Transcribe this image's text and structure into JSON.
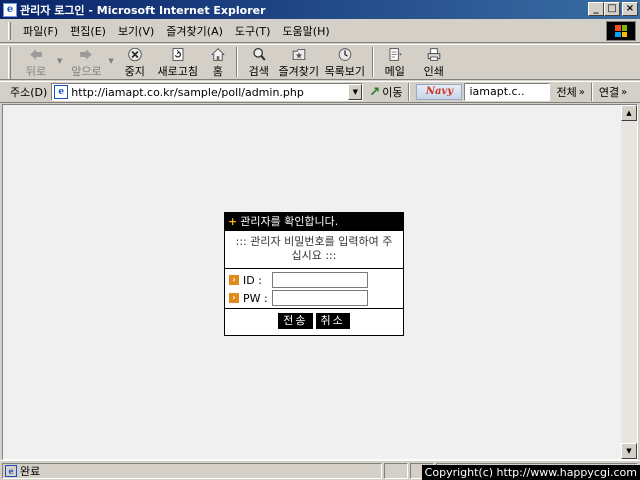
{
  "window": {
    "title": "관리자 로그인 - Microsoft Internet Explorer",
    "controls": {
      "minimize": "_",
      "maximize": "□",
      "close": "×"
    }
  },
  "menu": [
    "파일(F)",
    "편집(E)",
    "보기(V)",
    "즐겨찾기(A)",
    "도구(T)",
    "도움말(H)"
  ],
  "toolbar": {
    "back": "뒤로",
    "forward": "앞으로",
    "stop": "중지",
    "refresh": "새로고침",
    "home": "홈",
    "search": "검색",
    "favorites": "즐겨찾기",
    "history": "목록보기",
    "mail": "메일",
    "print": "인쇄"
  },
  "address": {
    "label": "주소(D)",
    "url": "http://iamapt.co.kr/sample/poll/admin.php",
    "go": "이동",
    "navy_logo": "Navy",
    "navy_search": "iamapt.c..",
    "navy_all": "전체",
    "links": "연결"
  },
  "login": {
    "header": "관리자를 확인합니다.",
    "message": "::: 관리자 비밀번호를 입력하여 주십시요 :::",
    "id_label": "ID :",
    "pw_label": "PW :",
    "id_value": "",
    "pw_value": "",
    "submit": "전송",
    "cancel": "취소"
  },
  "status": {
    "text": "완료",
    "copyright": "Copyright(c) http://www.happycgi.com"
  },
  "colors": {
    "titlebar_start": "#0a246a",
    "titlebar_end": "#3a6ea5",
    "chrome": "#d4d0c8",
    "content_bg": "#f0f0f0",
    "login_header": "#000000",
    "bullet": "#e08a1a"
  }
}
